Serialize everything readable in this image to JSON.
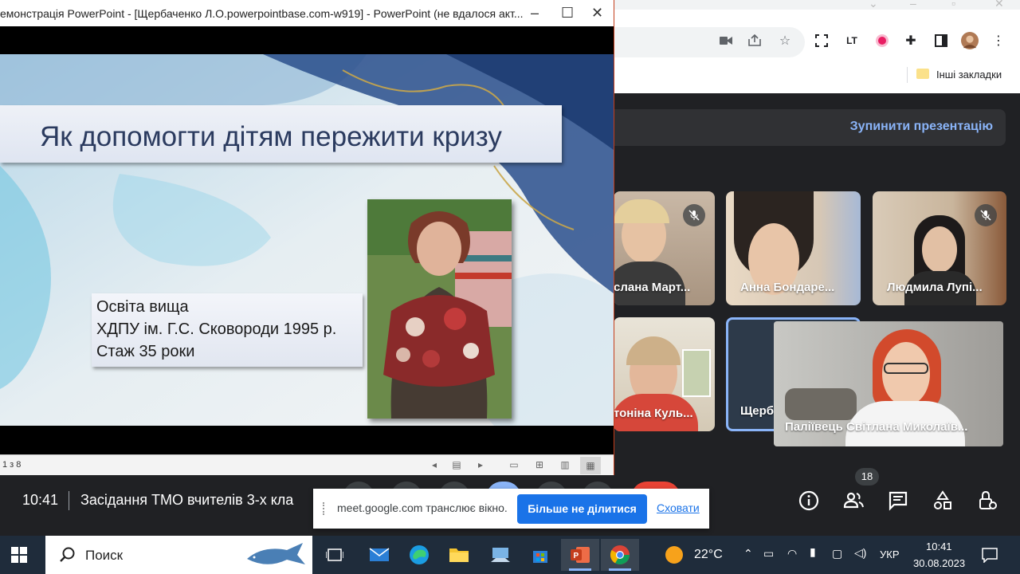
{
  "chrome": {
    "bookmarks_folder": "Інші закладки",
    "stop_presenting": "Зупинити презентацію"
  },
  "powerpoint": {
    "window_title": "емонстрація PowerPoint - [Щербаченко Л.О.powerpointbase.com-w919] - PowerPoint (не вдалося акт...",
    "slide_title": "Як допомогти дітям пережити кризу",
    "info_lines": [
      "Освіта вища",
      "ХДПУ ім. Г.С. Сковороди 1995 р.",
      "Стаж 35 роки"
    ],
    "slide_counter": "1 з 8"
  },
  "participants": [
    {
      "name": "слана Март...",
      "muted": true
    },
    {
      "name": "Анна Бондаре...",
      "muted": false
    },
    {
      "name": "Людмила Лупі...",
      "muted": true
    },
    {
      "name": "тоніна Куль...",
      "muted": false
    },
    {
      "name": "Щерб",
      "muted": false
    },
    {
      "name": "Паліївець Світлана Миколаїв...",
      "muted": false
    }
  ],
  "meet": {
    "time": "10:41",
    "meeting_title": "Засідання ТМО вчителів 3-х кла",
    "people_count": "18"
  },
  "share_bar": {
    "text": "meet.google.com транслює вікно.",
    "stop_button": "Більше не ділитися",
    "hide_link": "Сховати"
  },
  "taskbar": {
    "search_placeholder": "Поиск",
    "weather": "22°C",
    "language": "УКР",
    "clock_time": "10:41",
    "clock_date": "30.08.2023"
  },
  "colors": {
    "meet_bg": "#202124",
    "accent_blue": "#1a73e8",
    "stop_present_text": "#8ab4f8",
    "slide_title_text": "#2b3b5f",
    "taskbar_bg": "#1f2c3b"
  }
}
